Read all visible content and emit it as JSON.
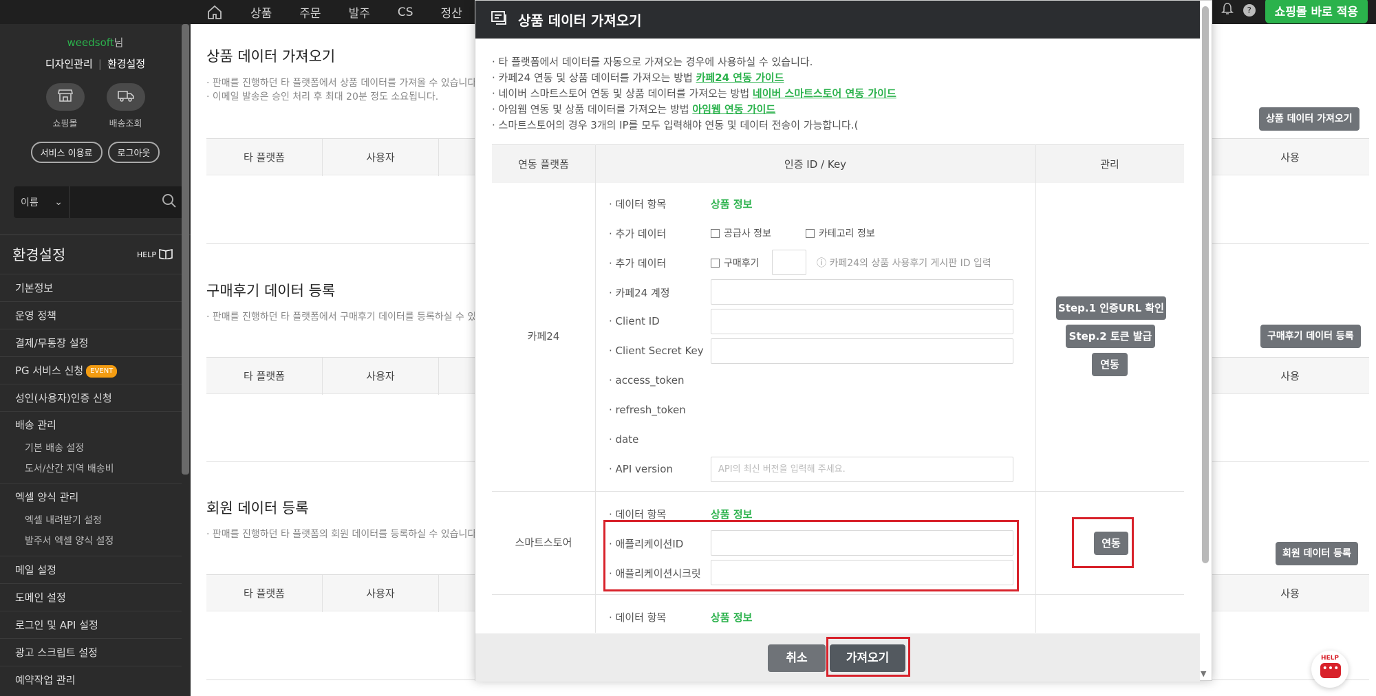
{
  "topnav": {
    "items": [
      "상품",
      "주문",
      "발주",
      "CS",
      "정산"
    ],
    "apply_label": "쇼핑몰 바로 적용",
    "help_q": "?"
  },
  "sidebar": {
    "user_name": "weedsoft",
    "user_suffix": "님",
    "link_design": "디자인관리",
    "link_settings": "환경설정",
    "quick_mall": "쇼핑몰",
    "quick_delivery": "배송조회",
    "pill_service": "서비스 이용료",
    "pill_logout": "로그아웃",
    "search_select": "이름",
    "section_title": "환경설정",
    "help_label": "HELP",
    "menu": {
      "basic_info": "기본정보",
      "policy": "운영 정책",
      "payment": "결제/무통장 설정",
      "pg": "PG 서비스 신청",
      "pg_badge": "EVENT",
      "adult": "성인(사용자)인증 신청",
      "delivery": "배송 관리",
      "delivery_basic": "기본 배송 설정",
      "delivery_island": "도서/산간 지역 배송비",
      "excel": "엑셀 양식 관리",
      "excel_download": "엑셀 내려받기 설정",
      "excel_order": "발주서 엑셀 양식 설정",
      "mail": "메일 설정",
      "domain": "도메인 설정",
      "login_api": "로그인 및 API 설정",
      "ad_script": "광고 스크립트 설정",
      "reserve": "예약작업 관리"
    }
  },
  "main": {
    "s1_title": "상품 데이터 가져오기",
    "s1_desc1": "· 판매를 진행하던 타 플랫폼에서 상품 데이터를 가져올 수 있습니다.",
    "s1_desc2": "· 이메일 발송은 승인 처리 후 최대 20분 정도 소요됩니다.",
    "s1_button": "상품 데이터 가져오기",
    "s2_title": "구매후기 데이터 등록",
    "s2_desc": "· 판매를 진행하던 타 플랫폼에서 구매후기 데이터를 등록하실 수 있습니다.",
    "s2_button": "구매후기 데이터 등록",
    "s3_title": "회원 데이터 등록",
    "s3_desc": "· 판매를 진행하던 타 플랫폼의 회원 데이터를 등록하실 수 있습니다.",
    "s3_button": "회원 데이터 등록",
    "col_platform": "타 플랫폼",
    "col_user": "사용자",
    "col_use": "사용"
  },
  "modal": {
    "title": "상품 데이터 가져오기",
    "note1": "· 타 플랫폼에서 데이터를 자동으로 가져오는 경우에 사용하실 수 있습니다.",
    "note2": "· 카페24 연동 및 상품 데이터를 가져오는 방법 ",
    "note2_link": "카페24 연동 가이드",
    "note3": "· 네이버 스마트스토어 연동 및 상품 데이터를 가져오는 방법 ",
    "note3_link": "네이버 스마트스토어 연동 가이드",
    "note4": "· 아임웹 연동 및 상품 데이터를 가져오는 방법 ",
    "note4_link": "아임웹 연동 가이드",
    "note5": "· 스마트스토어의 경우 3개의 IP를 모두 입력해야 연동 및 데이터 전송이 가능합니다.(",
    "th_platform": "연동 플랫폼",
    "th_key": "인증 ID / Key",
    "th_manage": "관리",
    "cafe24": {
      "name": "카페24",
      "lbl_items": "· 데이터 항목",
      "items_value": "상품 정보",
      "lbl_extra1": "· 추가 데이터",
      "chk_supplier": "공급사 정보",
      "chk_category": "카테고리 정보",
      "lbl_extra2": "· 추가 데이터",
      "chk_review": "구매후기",
      "review_hint": "ⓘ 카페24의 상품 사용후기 게시판 ID 입력",
      "lbl_account": "· 카페24 계정",
      "lbl_client_id": "· Client ID",
      "lbl_secret": "· Client Secret Key",
      "lbl_access": "· access_token",
      "lbl_refresh": "· refresh_token",
      "lbl_date": "· date",
      "lbl_api": "· API version",
      "api_placeholder": "API의 최신 버전을 입력해 주세요.",
      "btn_step1": "Step.1 인증URL 확인",
      "btn_step2": "Step.2 토큰 발급",
      "btn_link": "연동"
    },
    "smartstore": {
      "name": "스마트스토어",
      "lbl_items": "· 데이터 항목",
      "items_value": "상품 정보",
      "lbl_app_id": "· 애플리케이션ID",
      "lbl_app_secret": "· 애플리케이션시크릿",
      "btn_link": "연동"
    },
    "third": {
      "lbl_items": "· 데이터 항목",
      "items_value": "상품 정보"
    },
    "btn_cancel": "취소",
    "btn_import": "가져오기"
  },
  "help_fab": "HELP",
  "colors": {
    "accent_green": "#2bb24c",
    "highlight_red": "#d8222b",
    "button_gray": "#6f7378",
    "header_dark": "#2b2d30"
  }
}
